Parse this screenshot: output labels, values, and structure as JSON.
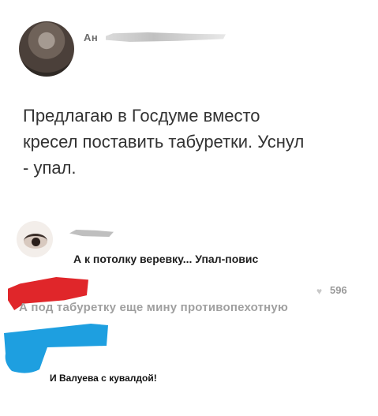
{
  "post": {
    "author_initials": "Ан",
    "text": "Предлагаю в Госдуме вместо\nкресел поставить табуретки. Уснул\n- упал."
  },
  "replies": [
    {
      "text": "А к потолку веревку... Упал-повис"
    },
    {
      "likes_icon": "heart-icon",
      "likes": "596",
      "text": "А под табуретку еще мину противопехотную"
    },
    {
      "text": "И Валуева с кувалдой!"
    }
  ],
  "colors": {
    "redaction_red": "#e0262a",
    "redaction_blue": "#1e9fe0"
  }
}
